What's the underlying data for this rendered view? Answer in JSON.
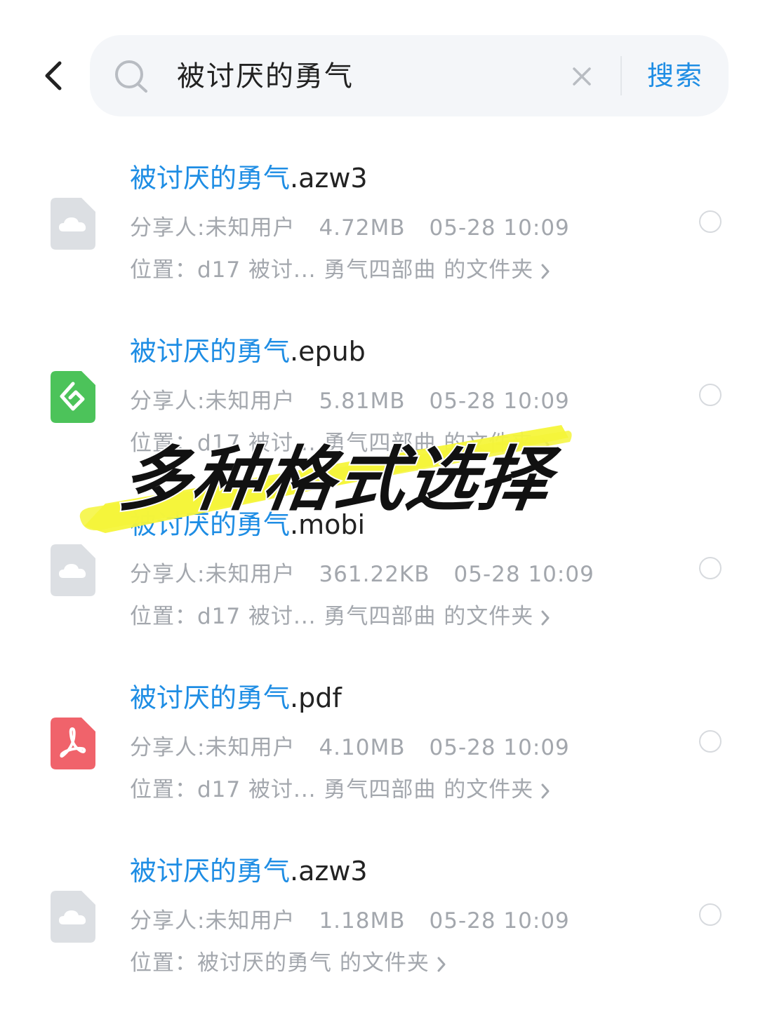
{
  "search": {
    "query": "被讨厌的勇气",
    "button_label": "搜索"
  },
  "results": [
    {
      "name_highlight": "被讨厌的勇气",
      "name_ext": ".azw3",
      "icon": "cloud-file-icon",
      "sharer": "分享人:未知用户",
      "size": "4.72MB",
      "time": "05-28 10:09",
      "location": "位置：d17 被讨... 勇气四部曲 的文件夹"
    },
    {
      "name_highlight": "被讨厌的勇气",
      "name_ext": ".epub",
      "icon": "epub-file-icon",
      "sharer": "分享人:未知用户",
      "size": "5.81MB",
      "time": "05-28 10:09",
      "location": "位置：d17 被讨... 勇气四部曲 的文件夹"
    },
    {
      "name_highlight": "被讨厌的勇气",
      "name_ext": ".mobi",
      "icon": "cloud-file-icon",
      "sharer": "分享人:未知用户",
      "size": "361.22KB",
      "time": "05-28 10:09",
      "location": "位置：d17 被讨... 勇气四部曲 的文件夹"
    },
    {
      "name_highlight": "被讨厌的勇气",
      "name_ext": ".pdf",
      "icon": "pdf-file-icon",
      "sharer": "分享人:未知用户",
      "size": "4.10MB",
      "time": "05-28 10:09",
      "location": "位置：d17 被讨... 勇气四部曲 的文件夹"
    },
    {
      "name_highlight": "被讨厌的勇气",
      "name_ext": ".azw3",
      "icon": "cloud-file-icon",
      "sharer": "分享人:未知用户",
      "size": "1.18MB",
      "time": "05-28 10:09",
      "location": "位置：被讨厌的勇气 的文件夹"
    }
  ],
  "overlay": {
    "caption": "多种格式选择"
  },
  "colors": {
    "accent": "#1e8de4",
    "muted_text": "#a3a7ad",
    "highlight_marker": "#f5f53a",
    "epub_green": "#4cc35a",
    "pdf_red": "#f0636b",
    "cloud_gray": "#dcdfe3"
  }
}
